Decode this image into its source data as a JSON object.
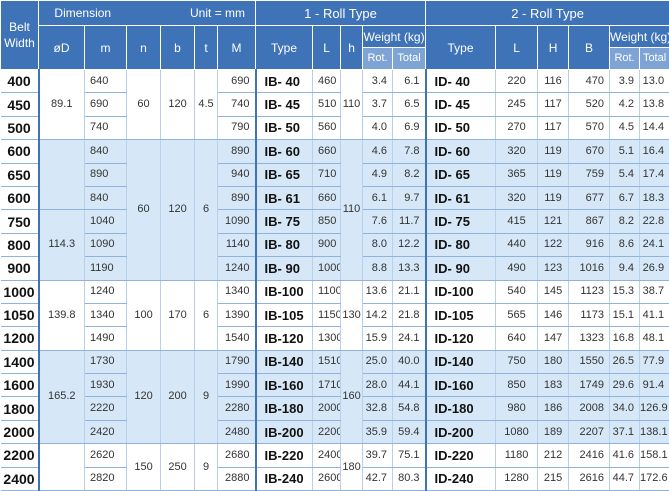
{
  "header": {
    "belt_width": "Belt\nWidth",
    "dimension": "Dimension",
    "unit": "Unit = mm",
    "roll1": "1 - Roll Type",
    "roll2": "2 - Roll Type",
    "od": "øD",
    "m": "m",
    "n": "n",
    "b": "b",
    "t": "t",
    "M": "M",
    "type": "Type",
    "L": "L",
    "h": "h",
    "H": "H",
    "B": "B",
    "weight": "Weight (kg)",
    "rot": "Rot.",
    "total": "Total"
  },
  "groups": [
    {
      "od": "89.1",
      "n": "60",
      "b": "120",
      "t": "4.5",
      "h": "110",
      "rows": 3,
      "shade": false
    },
    {
      "od": "",
      "n": "60",
      "b": "120",
      "t": "6",
      "h": "110",
      "rows": 6,
      "shade": true
    },
    {
      "od": "139.8",
      "n": "100",
      "b": "170",
      "t": "6",
      "h": "130",
      "rows": 3,
      "shade": false
    },
    {
      "od": "165.2",
      "n": "120",
      "b": "200",
      "t": "9",
      "h": "160",
      "rows": 4,
      "shade": true
    },
    {
      "od": "",
      "n": "150",
      "b": "250",
      "t": "9",
      "h": "180",
      "rows": 2,
      "shade": false
    }
  ],
  "od_114": "114.3",
  "rows": [
    {
      "belt": "400",
      "m": "640",
      "M": "690",
      "t1": "IB-  40",
      "L1": "460",
      "rot1": "3.4",
      "tot1": "6.1",
      "t2": "ID-  40",
      "L2": "220",
      "H": "116",
      "B": "470",
      "rot2": "3.9",
      "tot2": "13.0"
    },
    {
      "belt": "450",
      "m": "690",
      "M": "740",
      "t1": "IB-  45",
      "L1": "510",
      "rot1": "3.7",
      "tot1": "6.5",
      "t2": "ID-  45",
      "L2": "245",
      "H": "117",
      "B": "520",
      "rot2": "4.2",
      "tot2": "13.8"
    },
    {
      "belt": "500",
      "m": "740",
      "M": "790",
      "t1": "IB-  50",
      "L1": "560",
      "rot1": "4.0",
      "tot1": "6.9",
      "t2": "ID-  50",
      "L2": "270",
      "H": "117",
      "B": "570",
      "rot2": "4.5",
      "tot2": "14.4"
    },
    {
      "belt": "600",
      "m": "840",
      "M": "890",
      "t1": "IB-  60",
      "L1": "660",
      "rot1": "4.6",
      "tot1": "7.8",
      "t2": "ID-  60",
      "L2": "320",
      "H": "119",
      "B": "670",
      "rot2": "5.1",
      "tot2": "16.4"
    },
    {
      "belt": "650",
      "m": "890",
      "M": "940",
      "t1": "IB-  65",
      "L1": "710",
      "rot1": "4.9",
      "tot1": "8.2",
      "t2": "ID-  65",
      "L2": "365",
      "H": "119",
      "B": "759",
      "rot2": "5.4",
      "tot2": "17.4"
    },
    {
      "belt": "600",
      "m": "840",
      "M": "890",
      "t1": "IB-  61",
      "L1": "660",
      "rot1": "6.1",
      "tot1": "9.7",
      "t2": "ID-  61",
      "L2": "320",
      "H": "119",
      "B": "677",
      "rot2": "6.7",
      "tot2": "18.3"
    },
    {
      "belt": "750",
      "m": "1040",
      "M": "1090",
      "t1": "IB-  75",
      "L1": "850",
      "rot1": "7.6",
      "tot1": "11.7",
      "t2": "ID-  75",
      "L2": "415",
      "H": "121",
      "B": "867",
      "rot2": "8.2",
      "tot2": "22.8"
    },
    {
      "belt": "800",
      "m": "1090",
      "M": "1140",
      "t1": "IB-  80",
      "L1": "900",
      "rot1": "8.0",
      "tot1": "12.2",
      "t2": "ID-  80",
      "L2": "440",
      "H": "122",
      "B": "916",
      "rot2": "8.6",
      "tot2": "24.1"
    },
    {
      "belt": "900",
      "m": "1190",
      "M": "1240",
      "t1": "IB-  90",
      "L1": "1000",
      "rot1": "8.8",
      "tot1": "13.3",
      "t2": "ID-  90",
      "L2": "490",
      "H": "123",
      "B": "1016",
      "rot2": "9.4",
      "tot2": "26.9"
    },
    {
      "belt": "1000",
      "m": "1240",
      "M": "1340",
      "t1": "IB-100",
      "L1": "1100",
      "rot1": "13.6",
      "tot1": "21.1",
      "t2": "ID-100",
      "L2": "540",
      "H": "145",
      "B": "1123",
      "rot2": "15.3",
      "tot2": "38.7"
    },
    {
      "belt": "1050",
      "m": "1340",
      "M": "1390",
      "t1": "IB-105",
      "L1": "1150",
      "rot1": "14.2",
      "tot1": "21.8",
      "t2": "ID-105",
      "L2": "565",
      "H": "146",
      "B": "1173",
      "rot2": "15.1",
      "tot2": "41.1"
    },
    {
      "belt": "1200",
      "m": "1490",
      "M": "1540",
      "t1": "IB-120",
      "L1": "1300",
      "rot1": "15.9",
      "tot1": "24.1",
      "t2": "ID-120",
      "L2": "640",
      "H": "147",
      "B": "1323",
      "rot2": "16.8",
      "tot2": "48.1"
    },
    {
      "belt": "1400",
      "m": "1730",
      "M": "1790",
      "t1": "IB-140",
      "L1": "1510",
      "rot1": "25.0",
      "tot1": "40.0",
      "t2": "ID-140",
      "L2": "750",
      "H": "180",
      "B": "1550",
      "rot2": "26.5",
      "tot2": "77.9"
    },
    {
      "belt": "1600",
      "m": "1930",
      "M": "1990",
      "t1": "IB-160",
      "L1": "1710",
      "rot1": "28.0",
      "tot1": "44.1",
      "t2": "ID-160",
      "L2": "850",
      "H": "183",
      "B": "1749",
      "rot2": "29.6",
      "tot2": "91.4"
    },
    {
      "belt": "1800",
      "m": "2220",
      "M": "2280",
      "t1": "IB-180",
      "L1": "2000",
      "rot1": "32.8",
      "tot1": "54.8",
      "t2": "ID-180",
      "L2": "980",
      "H": "186",
      "B": "2008",
      "rot2": "34.0",
      "tot2": "126.9"
    },
    {
      "belt": "2000",
      "m": "2420",
      "M": "2480",
      "t1": "IB-200",
      "L1": "2200",
      "rot1": "35.9",
      "tot1": "59.4",
      "t2": "ID-200",
      "L2": "1080",
      "H": "189",
      "B": "2207",
      "rot2": "37.1",
      "tot2": "138.1"
    },
    {
      "belt": "2200",
      "m": "2620",
      "M": "2680",
      "t1": "IB-220",
      "L1": "2400",
      "rot1": "39.7",
      "tot1": "75.1",
      "t2": "ID-220",
      "L2": "1180",
      "H": "212",
      "B": "2416",
      "rot2": "41.6",
      "tot2": "158.1"
    },
    {
      "belt": "2400",
      "m": "2820",
      "M": "2880",
      "t1": "IB-240",
      "L1": "2600",
      "rot1": "42.7",
      "tot1": "80.3",
      "t2": "ID-240",
      "L2": "1280",
      "H": "215",
      "B": "2616",
      "rot2": "44.7",
      "tot2": "172.6"
    }
  ]
}
